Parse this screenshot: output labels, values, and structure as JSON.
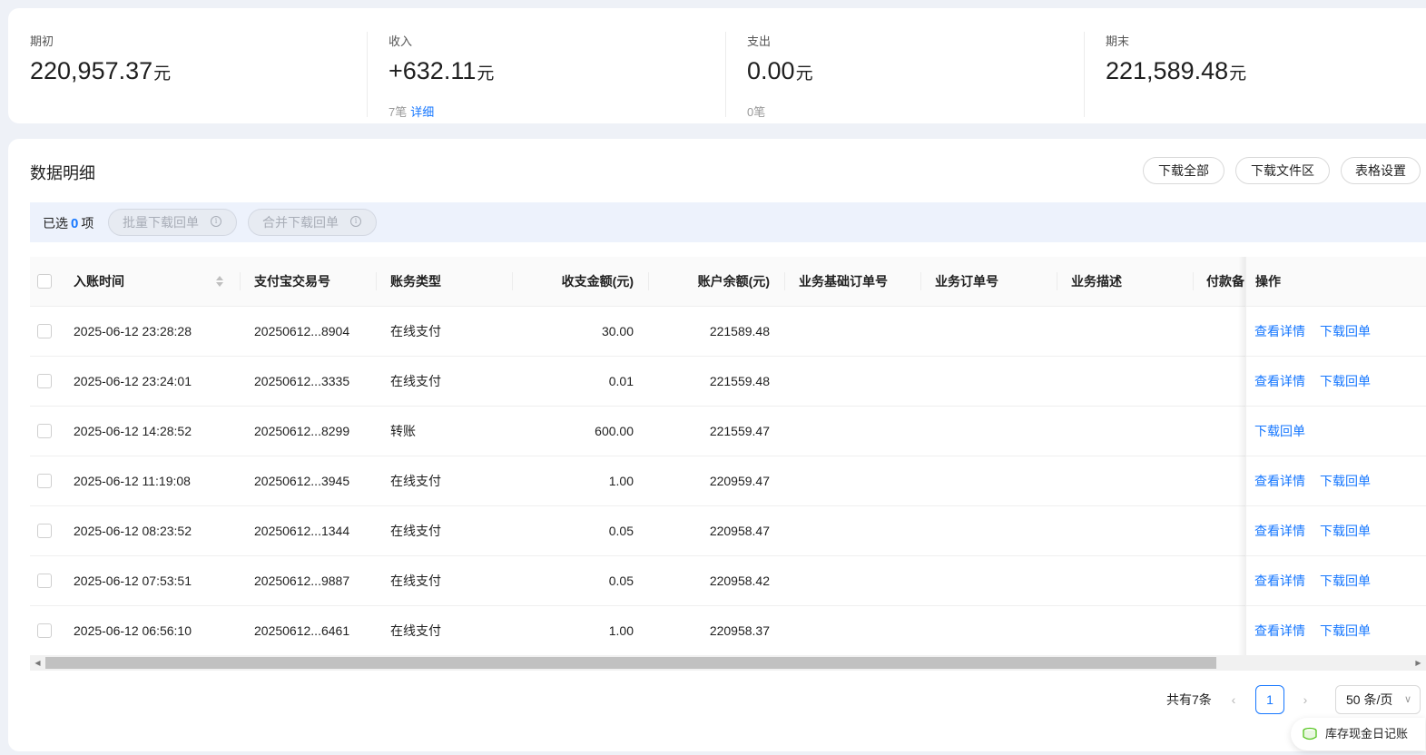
{
  "summary": {
    "items": [
      {
        "label": "期初",
        "value": "220,957.37",
        "unit": "元",
        "sub_count": "",
        "sub_link": ""
      },
      {
        "label": "收入",
        "value": "+632.11",
        "unit": "元",
        "sub_count": "7笔",
        "sub_link": "详细"
      },
      {
        "label": "支出",
        "value": "0.00",
        "unit": "元",
        "sub_count": "0笔",
        "sub_link": ""
      },
      {
        "label": "期末",
        "value": "221,589.48",
        "unit": "元",
        "sub_count": "",
        "sub_link": ""
      }
    ]
  },
  "detail": {
    "title": "数据明细",
    "toolbar": {
      "download_all": "下载全部",
      "download_area": "下载文件区",
      "table_settings": "表格设置"
    },
    "selection": {
      "prefix": "已选",
      "count": "0",
      "suffix": "项",
      "batch_download": "批量下载回单",
      "merge_download": "合并下载回单"
    },
    "columns": {
      "time": "入账时间",
      "trade_no": "支付宝交易号",
      "type": "账务类型",
      "amount": "收支金额(元)",
      "balance": "账户余额(元)",
      "base_order": "业务基础订单号",
      "order": "业务订单号",
      "desc": "业务描述",
      "payer": "付款备",
      "actions": "操作"
    },
    "rows": [
      {
        "time": "2025-06-12 23:28:28",
        "trade_no": "20250612...8904",
        "type": "在线支付",
        "amount": "30.00",
        "balance": "221589.48",
        "action1": "查看详情",
        "action2": "下载回单"
      },
      {
        "time": "2025-06-12 23:24:01",
        "trade_no": "20250612...3335",
        "type": "在线支付",
        "amount": "0.01",
        "balance": "221559.48",
        "action1": "查看详情",
        "action2": "下载回单"
      },
      {
        "time": "2025-06-12 14:28:52",
        "trade_no": "20250612...8299",
        "type": "转账",
        "amount": "600.00",
        "balance": "221559.47",
        "action1": "下载回单",
        "action2": ""
      },
      {
        "time": "2025-06-12 11:19:08",
        "trade_no": "20250612...3945",
        "type": "在线支付",
        "amount": "1.00",
        "balance": "220959.47",
        "action1": "查看详情",
        "action2": "下载回单"
      },
      {
        "time": "2025-06-12 08:23:52",
        "trade_no": "20250612...1344",
        "type": "在线支付",
        "amount": "0.05",
        "balance": "220958.47",
        "action1": "查看详情",
        "action2": "下载回单"
      },
      {
        "time": "2025-06-12 07:53:51",
        "trade_no": "20250612...9887",
        "type": "在线支付",
        "amount": "0.05",
        "balance": "220958.42",
        "action1": "查看详情",
        "action2": "下载回单"
      },
      {
        "time": "2025-06-12 06:56:10",
        "trade_no": "20250612...6461",
        "type": "在线支付",
        "amount": "1.00",
        "balance": "220958.37",
        "action1": "查看详情",
        "action2": "下载回单"
      }
    ],
    "pagination": {
      "total": "共有7条",
      "prev": "‹",
      "next": "›",
      "current_page": "1",
      "page_size": "50 条/页"
    },
    "float_button": "库存现金日记账"
  },
  "colors": {
    "accent": "#1677ff",
    "page_bg": "#eef1f7",
    "selection_bar_bg": "#edf2fc"
  },
  "icons": {
    "sort": "sort-icon",
    "info": "info-icon",
    "chevron_down": "chevron-down-icon",
    "journal": "journal-icon"
  }
}
